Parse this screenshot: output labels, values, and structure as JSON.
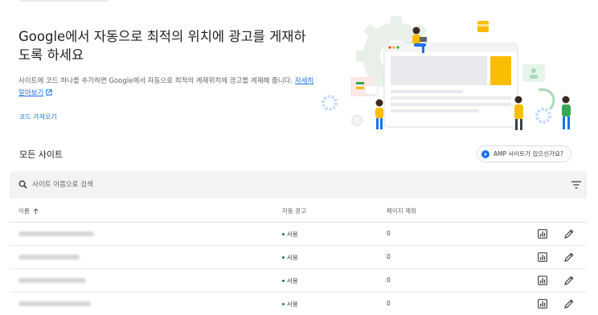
{
  "hero": {
    "title": "Google에서 자동으로 최적의 위치에 광고를 게재하도록 하세요",
    "description_prefix": "사이트에 코드 하나를 추가하면 Google에서 자동으로 최적의 게재위치에 광고를 게재해 줍니다.",
    "learn_more": "자세히 알아보기",
    "get_code": "코드 가져오기"
  },
  "sites": {
    "section_title": "모든 사이트",
    "amp_chip": "AMP 사이트가 있으신가요?",
    "search_placeholder": "사이트 이름으로 검색",
    "columns": {
      "name": "이름",
      "auto_ads": "자동 광고",
      "page_exclusions": "페이지 제외"
    },
    "rows": [
      {
        "status": "사용",
        "exclusions": "0"
      },
      {
        "status": "사용",
        "exclusions": "0"
      },
      {
        "status": "사용",
        "exclusions": "0"
      },
      {
        "status": "사용",
        "exclusions": "0"
      }
    ]
  },
  "icons": {
    "search": "search-icon",
    "filter": "filter-icon",
    "sort": "arrow-up-icon",
    "report": "bar-chart-icon",
    "edit": "pencil-icon",
    "external": "open-in-new-icon",
    "amp": "amp-bolt-icon"
  },
  "colors": {
    "link": "#1a73e8",
    "status_on": "#188038",
    "search_bg": "#f1f3f4",
    "illustration_accent": "#fbbc04"
  }
}
